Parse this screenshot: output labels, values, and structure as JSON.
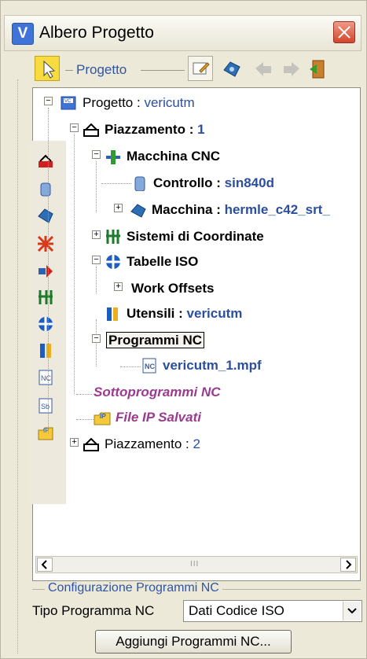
{
  "window": {
    "title": "Albero Progetto",
    "app_icon_letter": "V"
  },
  "toolbar": {
    "progetto_label": "Progetto"
  },
  "tree": {
    "root": {
      "label": "Progetto :",
      "value": "vericutm"
    },
    "setup1": {
      "label": "Piazzamento :",
      "value": "1"
    },
    "machine_cnc": {
      "label": "Macchina CNC"
    },
    "control": {
      "label": "Controllo :",
      "value": "sin840d"
    },
    "machine": {
      "label": "Macchina :",
      "value": "hermle_c42_srt_"
    },
    "coord_systems": {
      "label": "Sistemi di Coordinate"
    },
    "iso_tables": {
      "label": "Tabelle ISO"
    },
    "work_offsets": {
      "label": "Work Offsets"
    },
    "tools": {
      "label": "Utensili :",
      "value": "vericutm"
    },
    "nc_programs": {
      "label": "Programmi NC"
    },
    "nc_file": {
      "label": "vericutm_1.mpf"
    },
    "nc_subprograms": {
      "label": "Sottoprogrammi NC"
    },
    "ip_files": {
      "label": "File IP Salvati"
    },
    "setup2": {
      "label": "Piazzamento :",
      "value": "2"
    }
  },
  "config": {
    "section_title": "Configurazione Programmi NC",
    "type_label": "Tipo Programma NC",
    "type_value": "Dati Codice ISO",
    "add_button": "Aggiungi Programmi NC..."
  },
  "scrollbar": {
    "grip": "III"
  },
  "colors": {
    "accent_blue": "#2b4f9e",
    "purple": "#9a3a90",
    "panel_bg": "#ece9d8"
  }
}
